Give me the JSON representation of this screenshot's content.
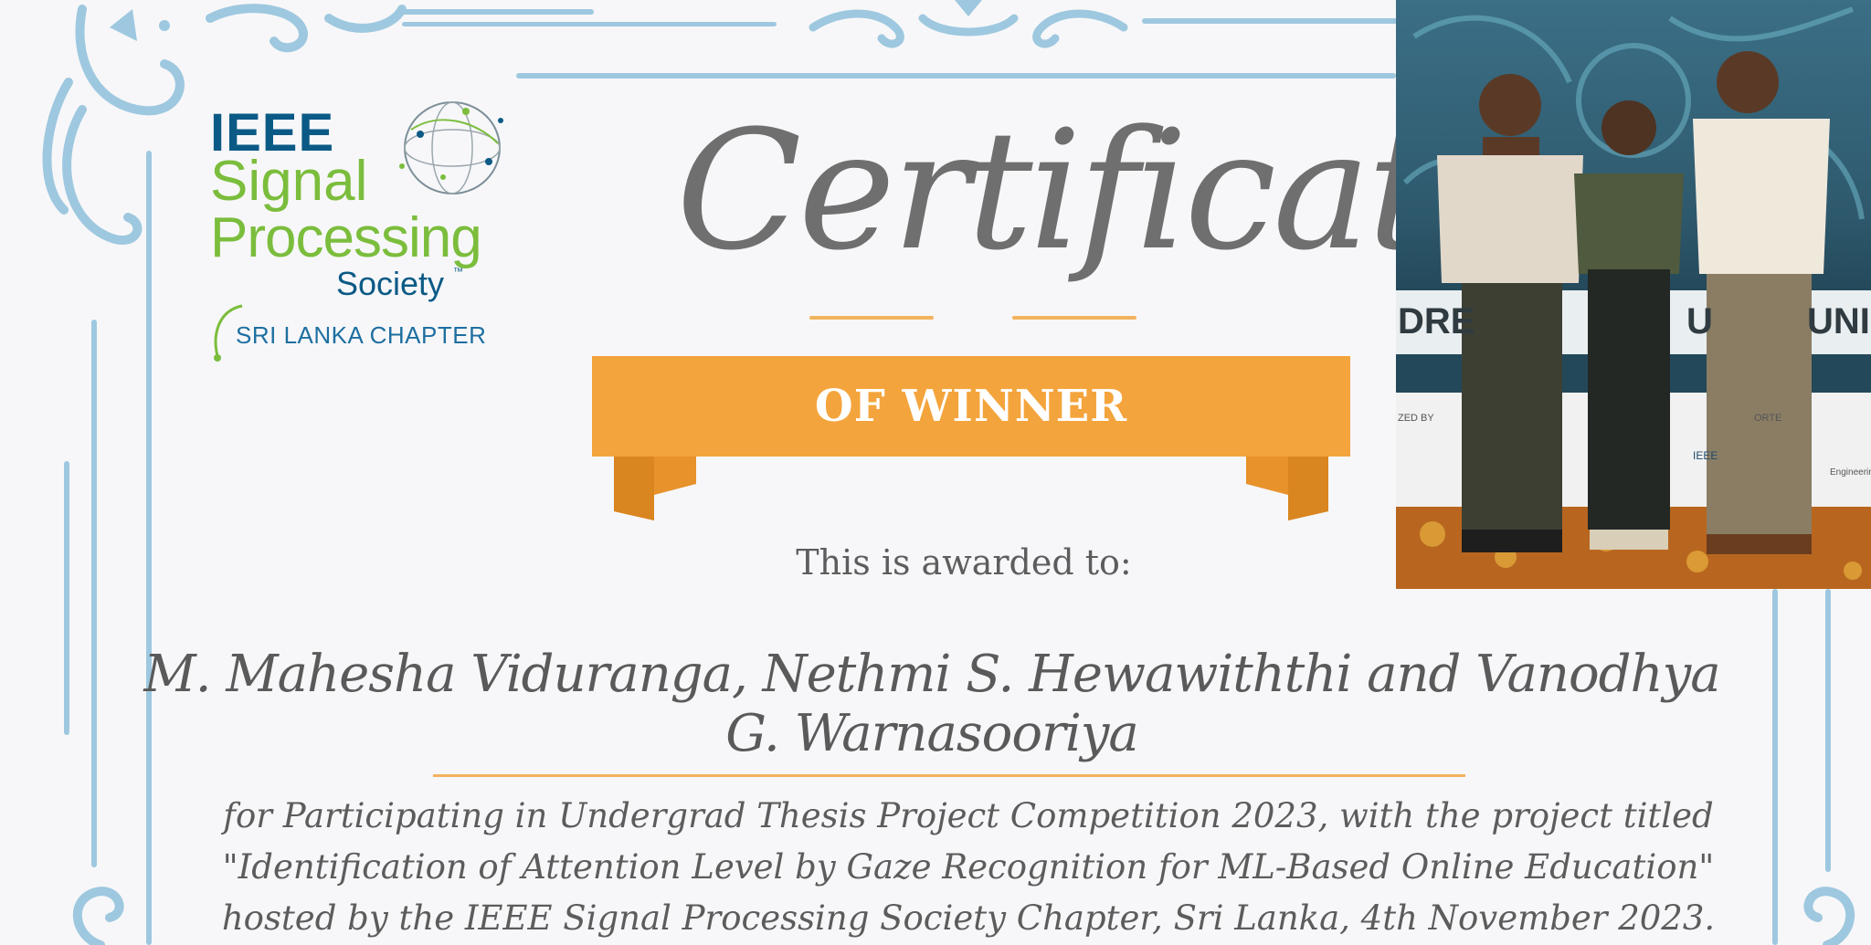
{
  "logo": {
    "ieee": "IEEE",
    "signal": "Signal",
    "processing": "Processing",
    "society": "Society",
    "trademark": "™",
    "chapter": "SRI LANKA CHAPTER"
  },
  "certificate": {
    "title": "Certificate",
    "ribbon_text": "OF WINNER",
    "awarded_to": "This is awarded to:",
    "recipients": "M. Mahesha Viduranga, Nethmi S. Hewawiththi and Vanodhya G. Warnasooriya",
    "description": "for Participating in Undergrad Thesis Project Competition 2023, with the project titled \"Identification of Attention Level by Gaze Recognition for ML-Based Online Education\" hosted by the IEEE Signal Processing Society Chapter, Sri Lanka, 4th November 2023."
  },
  "photo": {
    "banner_left": "DRE",
    "banner_mid": "U",
    "banner_right": "UNI",
    "sponsor_1": "ZED BY",
    "sponsor_2": "ORTE",
    "sponsor_3": "IEEE",
    "sponsor_4": "Engineering"
  },
  "colors": {
    "border_blue": "#9ec8df",
    "ribbon_orange": "#f4a43c",
    "ieee_blue": "#0b5a86",
    "sps_green": "#7bbd3c"
  }
}
